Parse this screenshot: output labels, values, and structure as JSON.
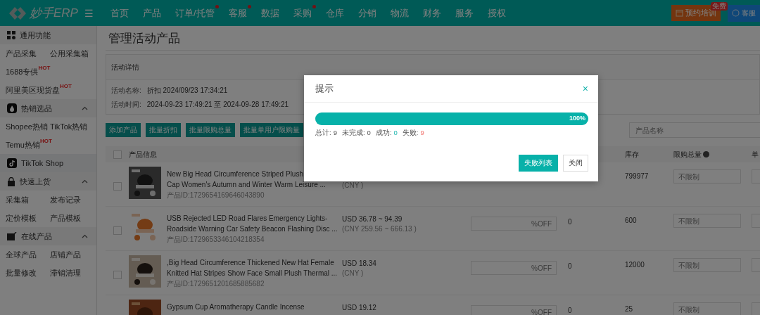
{
  "nav": {
    "logo": "妙手ERP",
    "menu_icon": "☰",
    "items": [
      {
        "label": "首页",
        "dot": false
      },
      {
        "label": "产品",
        "dot": false
      },
      {
        "label": "订单/托管",
        "dot": true
      },
      {
        "label": "客服",
        "dot": true
      },
      {
        "label": "数据",
        "dot": false
      },
      {
        "label": "采购",
        "dot": true
      },
      {
        "label": "仓库",
        "dot": false
      },
      {
        "label": "分销",
        "dot": false
      },
      {
        "label": "物流",
        "dot": false
      },
      {
        "label": "财务",
        "dot": false
      },
      {
        "label": "服务",
        "dot": false
      },
      {
        "label": "授权",
        "dot": false
      }
    ],
    "training": {
      "label": "预约培训",
      "badge": "免费"
    },
    "service": {
      "label": "客服"
    }
  },
  "sidebar": [
    {
      "title": "通用功能",
      "kind": "plain",
      "items": [
        {
          "label": "产品采集"
        },
        {
          "label": "公用采集箱"
        },
        {
          "label": "1688专供",
          "badge": "HOT"
        },
        {
          "label": "阿里美区现货盘",
          "badge": "HOT"
        }
      ]
    },
    {
      "title": "热销选品",
      "kind": "group",
      "expanded": true,
      "items": [
        {
          "label": "Shopee热销"
        },
        {
          "label": "TikTok热销"
        },
        {
          "label": "Temu热销",
          "badge": "HOT"
        }
      ]
    },
    {
      "title": "TikTok Shop",
      "kind": "link"
    },
    {
      "title": "快速上货",
      "kind": "group",
      "expanded": true,
      "items": [
        {
          "label": "采集箱"
        },
        {
          "label": "发布记录"
        },
        {
          "label": "定价模板"
        },
        {
          "label": "产品模板"
        }
      ]
    },
    {
      "title": "在线产品",
      "kind": "group",
      "expanded": true,
      "items": [
        {
          "label": "全球产品"
        },
        {
          "label": "店铺产品"
        },
        {
          "label": "批量修改"
        },
        {
          "label": "滞销清理"
        }
      ]
    }
  ],
  "page": {
    "title": "管理活动产品",
    "details": {
      "heading": "活动详情",
      "fields": [
        {
          "label": "活动名称:",
          "value": "折扣 2024/09/23 17:34:21"
        },
        {
          "label": "活动时间:",
          "value": "2024-09-23 17:49:21 至 2024-09-28 17:49:21"
        }
      ]
    },
    "actions": [
      "添加产品",
      "批量折扣",
      "批量限购总量",
      "批量单用户限购量"
    ],
    "search": {
      "placeholder": "产品名称"
    }
  },
  "table": {
    "columns": {
      "info": "产品信息",
      "stock": "库存",
      "limit": "限购总量",
      "per_user": "单"
    },
    "header_checked": false,
    "rows": [
      {
        "checked": false,
        "kind": "picture",
        "title_lines": [
          "New Big Head Circumference Striped Plush",
          "Cap Women's Autumn and Winter Warm Leisure ..."
        ],
        "product_id": "产品ID:1729654169646043890",
        "price_cny": "(CNY )",
        "stock": "799977",
        "limit_placeholder": "不限制"
      },
      {
        "checked": false,
        "kind": "picture",
        "title_lines": [
          "USB Rejected LED Road Flares Emergency Lights-",
          "Roadside Warning Car Safety Beacon Flashing Disc ..."
        ],
        "product_id": "产品ID:1729653346104218354",
        "price_usd": "USD 36.78 ~ 94.39",
        "price_cny": "(CNY 259.56 ~ 666.13 )",
        "discount_placeholder": "%OFF",
        "sold": "0",
        "stock": "600",
        "limit_placeholder": "不限制"
      },
      {
        "checked": false,
        "kind": "picture",
        "title_lines": [
          ",Big Head Circumference Thickened New Hat Female",
          "Knitted Hat Stripes Show Face Small Plush Thermal ..."
        ],
        "product_id": "产品ID:1729651201685885682",
        "price_usd": "USD 18.34",
        "price_cny": "(CNY )",
        "discount_placeholder": "%OFF",
        "sold": "0",
        "stock": "12000",
        "limit_placeholder": "不限制"
      },
      {
        "kind": "picture",
        "title_lines": [
          "Gypsum Cup Aromatherapy Candle Incense"
        ],
        "price_usd": "USD 19.12",
        "discount_placeholder": "%OFF",
        "sold": "0",
        "stock": "25",
        "limit_placeholder": "不限制"
      }
    ]
  },
  "dialog": {
    "title": "提示",
    "close": "×",
    "progress": {
      "level": 1,
      "reading": "100%"
    },
    "stats": [
      {
        "label": "总计:",
        "value": "9",
        "kind": "plain"
      },
      {
        "label": "未完成:",
        "value": "0",
        "kind": "plain"
      },
      {
        "label": "成功:",
        "value": "0",
        "kind": "success"
      },
      {
        "label": "失败:",
        "value": "9",
        "kind": "fail"
      }
    ],
    "buttons": [
      {
        "label": "失败列表",
        "kind": "primary"
      },
      {
        "label": "关闭",
        "kind": "default"
      }
    ]
  }
}
